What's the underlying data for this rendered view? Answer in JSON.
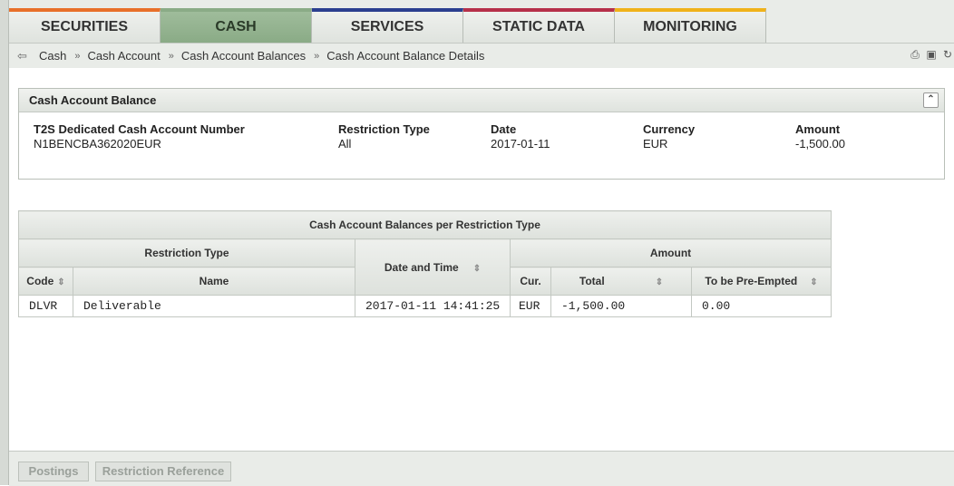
{
  "tabs": [
    {
      "label": "SECURITIES",
      "color": "#e8702a",
      "active": false
    },
    {
      "label": "CASH",
      "color": "#8aab86",
      "active": true
    },
    {
      "label": "SERVICES",
      "color": "#2b3f8f",
      "active": false
    },
    {
      "label": "STATIC DATA",
      "color": "#b6304a",
      "active": false
    },
    {
      "label": "MONITORING",
      "color": "#f0b21a",
      "active": false
    }
  ],
  "breadcrumb": [
    "Cash",
    "Cash Account",
    "Cash Account Balances",
    "Cash Account Balance Details"
  ],
  "breadcrumb_sep": "»",
  "tools": [
    "print-icon",
    "save-icon",
    "refresh-icon"
  ],
  "panel": {
    "title": "Cash Account Balance",
    "fields": [
      {
        "label": "T2S Dedicated Cash Account Number",
        "value": "N1BENCBA362020EUR"
      },
      {
        "label": "Restriction Type",
        "value": "All"
      },
      {
        "label": "Date",
        "value": "2017-01-11"
      },
      {
        "label": "Currency",
        "value": "EUR"
      },
      {
        "label": "Amount",
        "value": "-1,500.00"
      }
    ]
  },
  "table": {
    "caption": "Cash Account Balances per Restriction Type",
    "group_restriction": "Restriction Type",
    "date_time": "Date and Time",
    "group_amount": "Amount",
    "code": "Code",
    "name": "Name",
    "cur": "Cur.",
    "total": "Total",
    "preempted": "To be Pre-Empted",
    "rows": [
      {
        "code": "DLVR",
        "name": "Deliverable",
        "datetime": "2017-01-11 14:41:25",
        "cur": "EUR",
        "total": "-1,500.00",
        "preempted": "0.00"
      }
    ]
  },
  "footer": {
    "postings": "Postings",
    "restriction_reference": "Restriction Reference"
  }
}
